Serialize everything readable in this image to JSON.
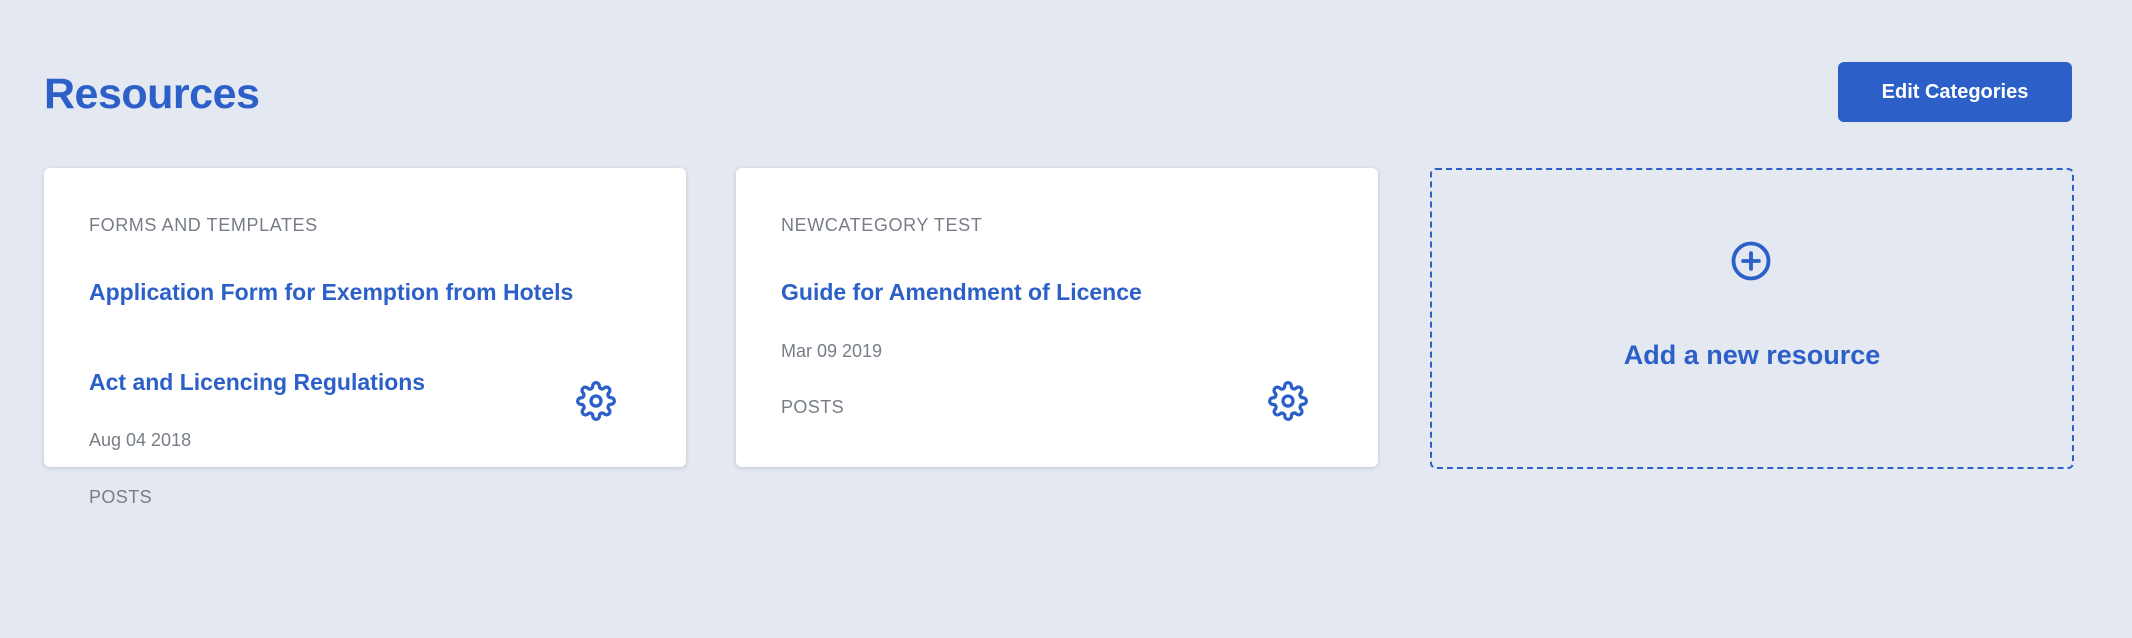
{
  "header": {
    "title": "Resources",
    "edit_categories_label": "Edit Categories"
  },
  "resources": [
    {
      "category": "FORMS AND TEMPLATES",
      "title": "Application Form for Exemption from Hotels Act and Licencing Regulations",
      "date": "Aug 04 2018",
      "type": "POSTS",
      "settings_icon": "gear-icon"
    },
    {
      "category": "NEWCATEGORY TEST",
      "title": "Guide for Amendment of Licence",
      "date": "Mar 09 2019",
      "type": "POSTS",
      "settings_icon": "gear-icon"
    }
  ],
  "add_resource": {
    "label": "Add a new resource",
    "icon": "plus-circle-icon"
  },
  "colors": {
    "background": "#e4e8f1",
    "accent": "#2c60c8",
    "muted_text": "#777d86",
    "card": "#ffffff"
  }
}
